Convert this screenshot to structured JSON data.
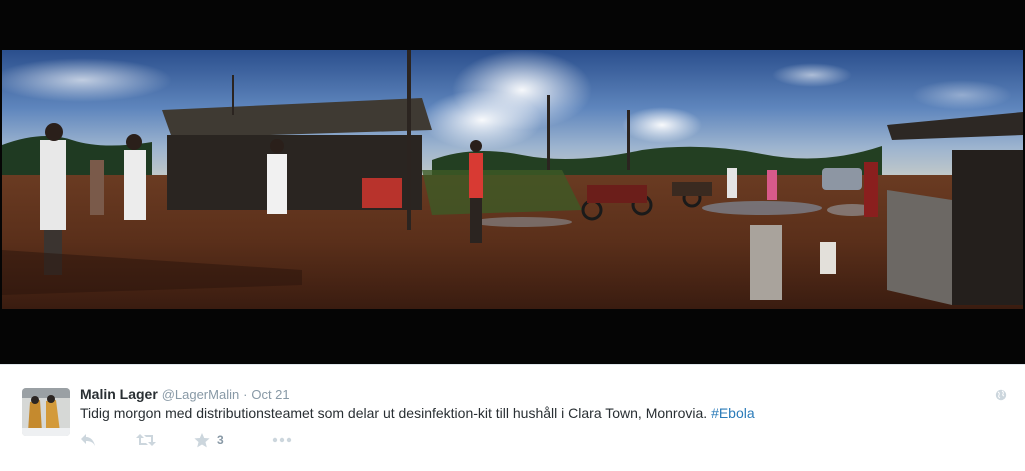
{
  "tweet": {
    "fullname": "Malin Lager",
    "username": "@LagerMalin",
    "separator": "·",
    "timestamp": "Oct 21",
    "text": "Tidig morgon med distributionsteamet som delar ut desinfektion-kit till hushåll i Clara Town, Monrovia. ",
    "hashtag": "#Ebola",
    "favorite_count": "3"
  },
  "icons": {
    "reply": "reply-icon",
    "retweet": "retweet-icon",
    "favorite": "star-icon",
    "more": "more-icon",
    "location": "globe-icon"
  },
  "colors": {
    "link": "#2b7bb9",
    "action_icon": "#ccd6dd",
    "meta_text": "#8899a6",
    "name_text": "#292f33",
    "media_background": "#050505"
  }
}
